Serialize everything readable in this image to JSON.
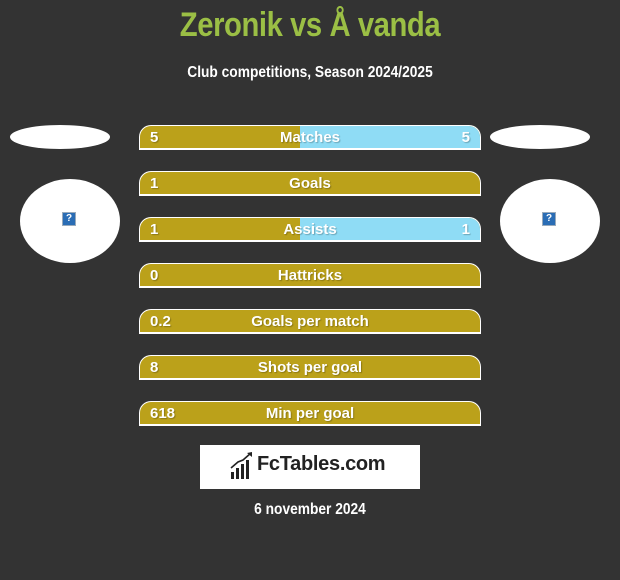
{
  "header": {
    "title": "Zeronik vs Å vanda",
    "subtitle": "Club competitions, Season 2024/2025"
  },
  "teams": {
    "left": {
      "logo_icon": "broken-image-icon",
      "logo_glyph": "?"
    },
    "right": {
      "logo_icon": "broken-image-icon",
      "logo_glyph": "?"
    }
  },
  "colors": {
    "left_bar": "#bba11a",
    "right_bar": "#8fdcf5",
    "title": "#9bbf45",
    "background": "#333333"
  },
  "stats": [
    {
      "label": "Matches",
      "left": "5",
      "right": "5",
      "left_share": 0.47
    },
    {
      "label": "Goals",
      "left": "1",
      "right": "",
      "left_share": 1.0
    },
    {
      "label": "Assists",
      "left": "1",
      "right": "1",
      "left_share": 0.47
    },
    {
      "label": "Hattricks",
      "left": "0",
      "right": "",
      "left_share": 1.0
    },
    {
      "label": "Goals per match",
      "left": "0.2",
      "right": "",
      "left_share": 1.0
    },
    {
      "label": "Shots per goal",
      "left": "8",
      "right": "",
      "left_share": 1.0
    },
    {
      "label": "Min per goal",
      "left": "618",
      "right": "",
      "left_share": 1.0
    }
  ],
  "footer": {
    "brand": "FcTables.com",
    "brand_icon": "bar-chart-icon",
    "date": "6 november 2024"
  }
}
